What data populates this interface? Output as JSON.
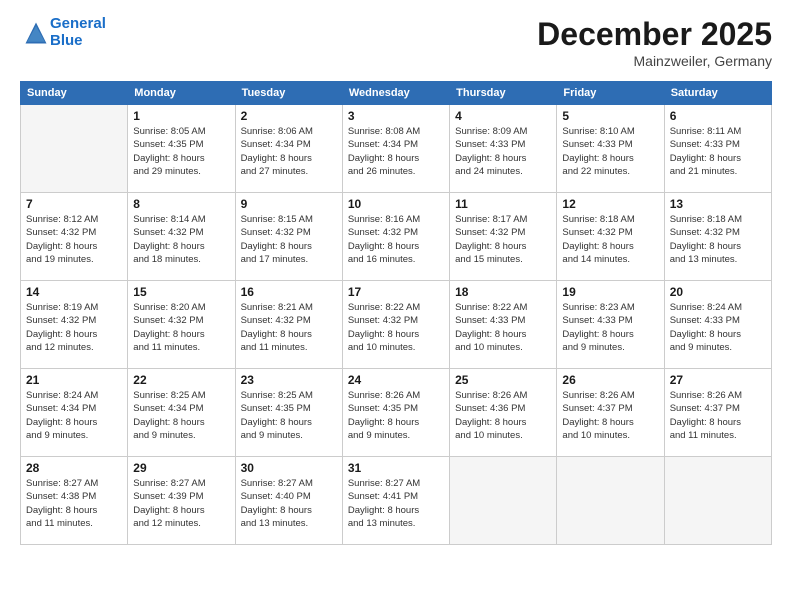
{
  "logo": {
    "line1": "General",
    "line2": "Blue"
  },
  "title": "December 2025",
  "location": "Mainzweiler, Germany",
  "headers": [
    "Sunday",
    "Monday",
    "Tuesday",
    "Wednesday",
    "Thursday",
    "Friday",
    "Saturday"
  ],
  "weeks": [
    [
      {
        "day": "",
        "info": ""
      },
      {
        "day": "1",
        "info": "Sunrise: 8:05 AM\nSunset: 4:35 PM\nDaylight: 8 hours\nand 29 minutes."
      },
      {
        "day": "2",
        "info": "Sunrise: 8:06 AM\nSunset: 4:34 PM\nDaylight: 8 hours\nand 27 minutes."
      },
      {
        "day": "3",
        "info": "Sunrise: 8:08 AM\nSunset: 4:34 PM\nDaylight: 8 hours\nand 26 minutes."
      },
      {
        "day": "4",
        "info": "Sunrise: 8:09 AM\nSunset: 4:33 PM\nDaylight: 8 hours\nand 24 minutes."
      },
      {
        "day": "5",
        "info": "Sunrise: 8:10 AM\nSunset: 4:33 PM\nDaylight: 8 hours\nand 22 minutes."
      },
      {
        "day": "6",
        "info": "Sunrise: 8:11 AM\nSunset: 4:33 PM\nDaylight: 8 hours\nand 21 minutes."
      }
    ],
    [
      {
        "day": "7",
        "info": "Sunrise: 8:12 AM\nSunset: 4:32 PM\nDaylight: 8 hours\nand 19 minutes."
      },
      {
        "day": "8",
        "info": "Sunrise: 8:14 AM\nSunset: 4:32 PM\nDaylight: 8 hours\nand 18 minutes."
      },
      {
        "day": "9",
        "info": "Sunrise: 8:15 AM\nSunset: 4:32 PM\nDaylight: 8 hours\nand 17 minutes."
      },
      {
        "day": "10",
        "info": "Sunrise: 8:16 AM\nSunset: 4:32 PM\nDaylight: 8 hours\nand 16 minutes."
      },
      {
        "day": "11",
        "info": "Sunrise: 8:17 AM\nSunset: 4:32 PM\nDaylight: 8 hours\nand 15 minutes."
      },
      {
        "day": "12",
        "info": "Sunrise: 8:18 AM\nSunset: 4:32 PM\nDaylight: 8 hours\nand 14 minutes."
      },
      {
        "day": "13",
        "info": "Sunrise: 8:18 AM\nSunset: 4:32 PM\nDaylight: 8 hours\nand 13 minutes."
      }
    ],
    [
      {
        "day": "14",
        "info": "Sunrise: 8:19 AM\nSunset: 4:32 PM\nDaylight: 8 hours\nand 12 minutes."
      },
      {
        "day": "15",
        "info": "Sunrise: 8:20 AM\nSunset: 4:32 PM\nDaylight: 8 hours\nand 11 minutes."
      },
      {
        "day": "16",
        "info": "Sunrise: 8:21 AM\nSunset: 4:32 PM\nDaylight: 8 hours\nand 11 minutes."
      },
      {
        "day": "17",
        "info": "Sunrise: 8:22 AM\nSunset: 4:32 PM\nDaylight: 8 hours\nand 10 minutes."
      },
      {
        "day": "18",
        "info": "Sunrise: 8:22 AM\nSunset: 4:33 PM\nDaylight: 8 hours\nand 10 minutes."
      },
      {
        "day": "19",
        "info": "Sunrise: 8:23 AM\nSunset: 4:33 PM\nDaylight: 8 hours\nand 9 minutes."
      },
      {
        "day": "20",
        "info": "Sunrise: 8:24 AM\nSunset: 4:33 PM\nDaylight: 8 hours\nand 9 minutes."
      }
    ],
    [
      {
        "day": "21",
        "info": "Sunrise: 8:24 AM\nSunset: 4:34 PM\nDaylight: 8 hours\nand 9 minutes."
      },
      {
        "day": "22",
        "info": "Sunrise: 8:25 AM\nSunset: 4:34 PM\nDaylight: 8 hours\nand 9 minutes."
      },
      {
        "day": "23",
        "info": "Sunrise: 8:25 AM\nSunset: 4:35 PM\nDaylight: 8 hours\nand 9 minutes."
      },
      {
        "day": "24",
        "info": "Sunrise: 8:26 AM\nSunset: 4:35 PM\nDaylight: 8 hours\nand 9 minutes."
      },
      {
        "day": "25",
        "info": "Sunrise: 8:26 AM\nSunset: 4:36 PM\nDaylight: 8 hours\nand 10 minutes."
      },
      {
        "day": "26",
        "info": "Sunrise: 8:26 AM\nSunset: 4:37 PM\nDaylight: 8 hours\nand 10 minutes."
      },
      {
        "day": "27",
        "info": "Sunrise: 8:26 AM\nSunset: 4:37 PM\nDaylight: 8 hours\nand 11 minutes."
      }
    ],
    [
      {
        "day": "28",
        "info": "Sunrise: 8:27 AM\nSunset: 4:38 PM\nDaylight: 8 hours\nand 11 minutes."
      },
      {
        "day": "29",
        "info": "Sunrise: 8:27 AM\nSunset: 4:39 PM\nDaylight: 8 hours\nand 12 minutes."
      },
      {
        "day": "30",
        "info": "Sunrise: 8:27 AM\nSunset: 4:40 PM\nDaylight: 8 hours\nand 13 minutes."
      },
      {
        "day": "31",
        "info": "Sunrise: 8:27 AM\nSunset: 4:41 PM\nDaylight: 8 hours\nand 13 minutes."
      },
      {
        "day": "",
        "info": ""
      },
      {
        "day": "",
        "info": ""
      },
      {
        "day": "",
        "info": ""
      }
    ]
  ]
}
